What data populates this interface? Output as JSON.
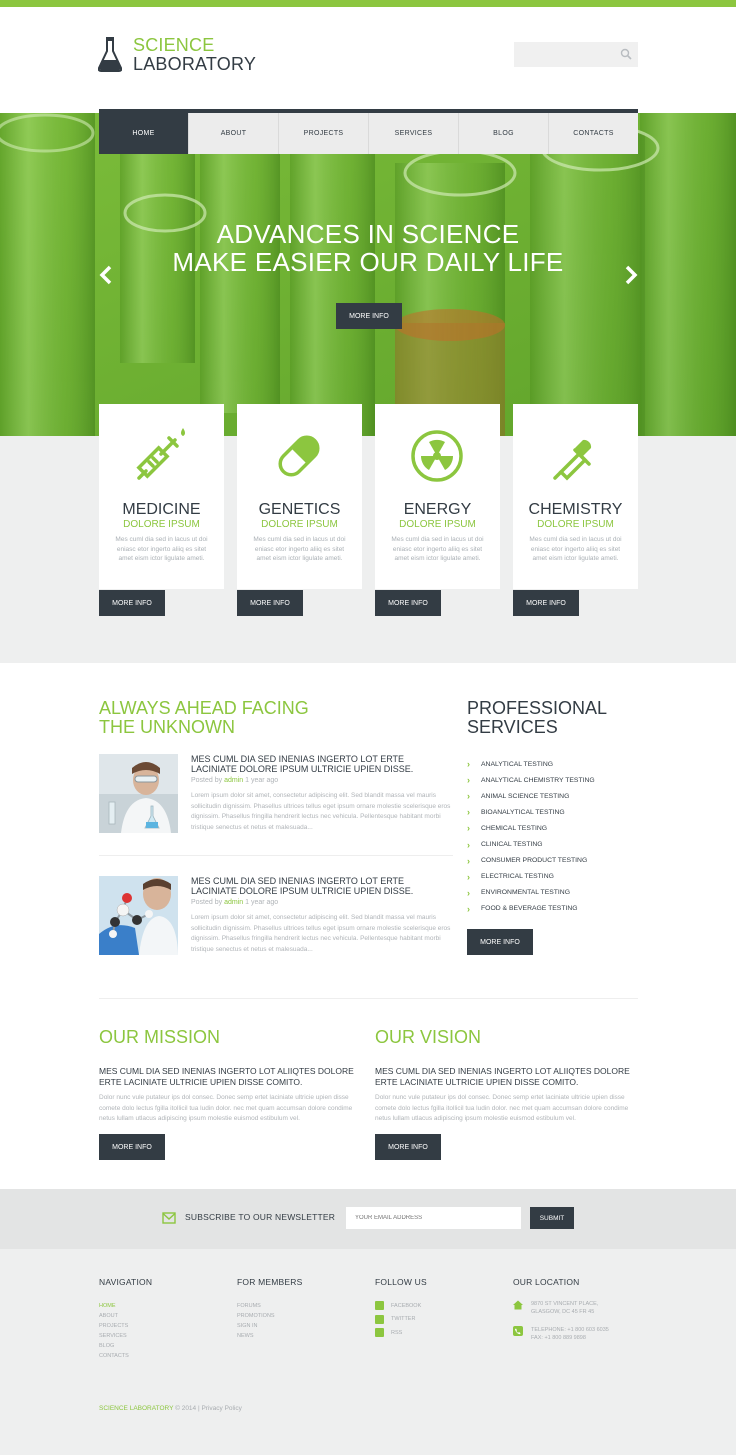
{
  "header": {
    "logo_line1": "SCIENCE",
    "logo_line2": "LABORATORY",
    "search_placeholder": ""
  },
  "nav": {
    "items": [
      "HOME",
      "ABOUT",
      "PROJECTS",
      "SERVICES",
      "BLOG",
      "CONTACTS"
    ],
    "active": "HOME"
  },
  "hero": {
    "title_line1": "ADVANCES IN SCIENCE",
    "title_line2": "MAKE EASIER OUR DAILY LIFE",
    "button": "MORE INFO"
  },
  "features": [
    {
      "title": "MEDICINE",
      "subtitle": "DOLORE IPSUM",
      "text": "Mes cuml dia sed in lacus ut doi eniasc etor ingerto aliiq es sitet amet eism ictor ligulate ameti.",
      "button": "MORE INFO",
      "icon": "syringe-icon"
    },
    {
      "title": "GENETICS",
      "subtitle": "DOLORE IPSUM",
      "text": "Mes cuml dia sed in lacus ut doi eniasc etor ingerto aliiq es sitet amet eism ictor ligulate ameti.",
      "button": "MORE INFO",
      "icon": "pill-icon"
    },
    {
      "title": "ENERGY",
      "subtitle": "DOLORE IPSUM",
      "text": "Mes cuml dia sed in lacus ut doi eniasc etor ingerto aliiq es sitet amet eism ictor ligulate ameti.",
      "button": "MORE INFO",
      "icon": "radiation-icon"
    },
    {
      "title": "CHEMISTRY",
      "subtitle": "DOLORE IPSUM",
      "text": "Mes cuml dia sed in lacus ut doi eniasc etor ingerto aliiq es sitet amet eism ictor ligulate ameti.",
      "button": "MORE INFO",
      "icon": "dropper-icon"
    }
  ],
  "ahead": {
    "title_line1": "ALWAYS AHEAD FACING",
    "title_line2": "THE UNKNOWN",
    "posts": [
      {
        "title": "MES CUML DIA SED INENIAS INGERTO LOT ERTE LACINIATE DOLORE IPSUM ULTRICIE UPIEN DISSE.",
        "posted_by": "Posted by",
        "author": "admin",
        "time": "1 year ago",
        "text": "Lorem ipsum dolor sit amet, consectetur adipiscing elit. Sed blandit massa vel mauris sollicitudin dignissim. Phasellus ultrices tellus eget ipsum ornare molestie scelerisque eros dignissim. Phasellus fringilla hendrerit lectus nec vehicula. Pellentesque habitant morbi tristique senectus et netus et malesuada..."
      },
      {
        "title": "MES CUML DIA SED INENIAS INGERTO LOT ERTE LACINIATE DOLORE IPSUM ULTRICIE UPIEN DISSE.",
        "posted_by": "Posted by",
        "author": "admin",
        "time": "1 year ago",
        "text": "Lorem ipsum dolor sit amet, consectetur adipiscing elit. Sed blandit massa vel mauris sollicitudin dignissim. Phasellus ultrices tellus eget ipsum ornare molestie scelerisque eros dignissim. Phasellus fringilla hendrerit lectus nec vehicula. Pellentesque habitant morbi tristique senectus et netus et malesuada..."
      }
    ]
  },
  "professional": {
    "title_line1": "PROFESSIONAL",
    "title_line2": "SERVICES",
    "items": [
      "ANALYTICAL TESTING",
      "ANALYTICAL CHEMISTRY TESTING",
      "ANIMAL SCIENCE TESTING",
      "BIOANALYTICAL TESTING",
      "CHEMICAL TESTING",
      "CLINICAL TESTING",
      "CONSUMER PRODUCT TESTING",
      "ELECTRICAL TESTING",
      "ENVIRONMENTAL TESTING",
      "FOOD & BEVERAGE TESTING"
    ],
    "button": "MORE INFO"
  },
  "mission": {
    "title": "OUR MISSION",
    "subtitle": "MES CUML DIA SED INENIAS INGERTO LOT ALIIQTES DOLORE ERTE LACINIATE ULTRICIE UPIEN DISSE COMITO.",
    "text": "Dolor nunc vule putateur ips dol consec. Donec semp ertet laciniate ultricie upien disse comete dolo lectus fgilla itollicil tua ludin dolor. nec met quam accumsan dolore condime netus lullam utlacus adipiscing ipsum molestie euismod estibulum vel.",
    "button": "MORE INFO"
  },
  "vision": {
    "title": "OUR VISION",
    "subtitle": "MES CUML DIA SED INENIAS INGERTO LOT ALIIQTES DOLORE ERTE LACINIATE ULTRICIE UPIEN DISSE COMITO.",
    "text": "Dolor nunc vule putateur ips dol consec. Donec semp ertet laciniate ultricie upien disse comete dolo lectus fgilla itollicil tua ludin dolor. nec met quam accumsan dolore condime netus lullam utlacus adipiscing ipsum molestie euismod estibulum vel.",
    "button": "MORE INFO"
  },
  "newsletter": {
    "label": "SUBSCRIBE TO OUR NEWSLETTER",
    "placeholder": "YOUR EMAIL ADDRESS",
    "button": "SUBMIT"
  },
  "footer": {
    "navigation": {
      "title": "NAVIGATION",
      "items": [
        "HOME",
        "ABOUT",
        "PROJECTS",
        "SERVICES",
        "BLOG",
        "CONTACTS"
      ]
    },
    "members": {
      "title": "FOR MEMBERS",
      "items": [
        "FORUMS",
        "PROMOTIONS",
        "SIGN IN",
        "NEWS"
      ]
    },
    "follow": {
      "title": "FOLLOW US",
      "items": [
        "FACEBOOK",
        "TWITTER",
        "RSS"
      ]
    },
    "location": {
      "title": "OUR LOCATION",
      "address1": "9870 ST VINCENT PLACE,",
      "address2": "GLASGOW, DC 45 FR 45",
      "phone": "TELEPHONE: +1 800 603 6035",
      "fax": "FAX: +1 800 889 9898"
    },
    "copyright_brand": "SCIENCE LABORATORY",
    "copyright_rest": "© 2014 | Privacy Policy"
  },
  "colors": {
    "accent": "#8cc63f",
    "dark": "#333c44",
    "light_gray": "#eeefef"
  }
}
